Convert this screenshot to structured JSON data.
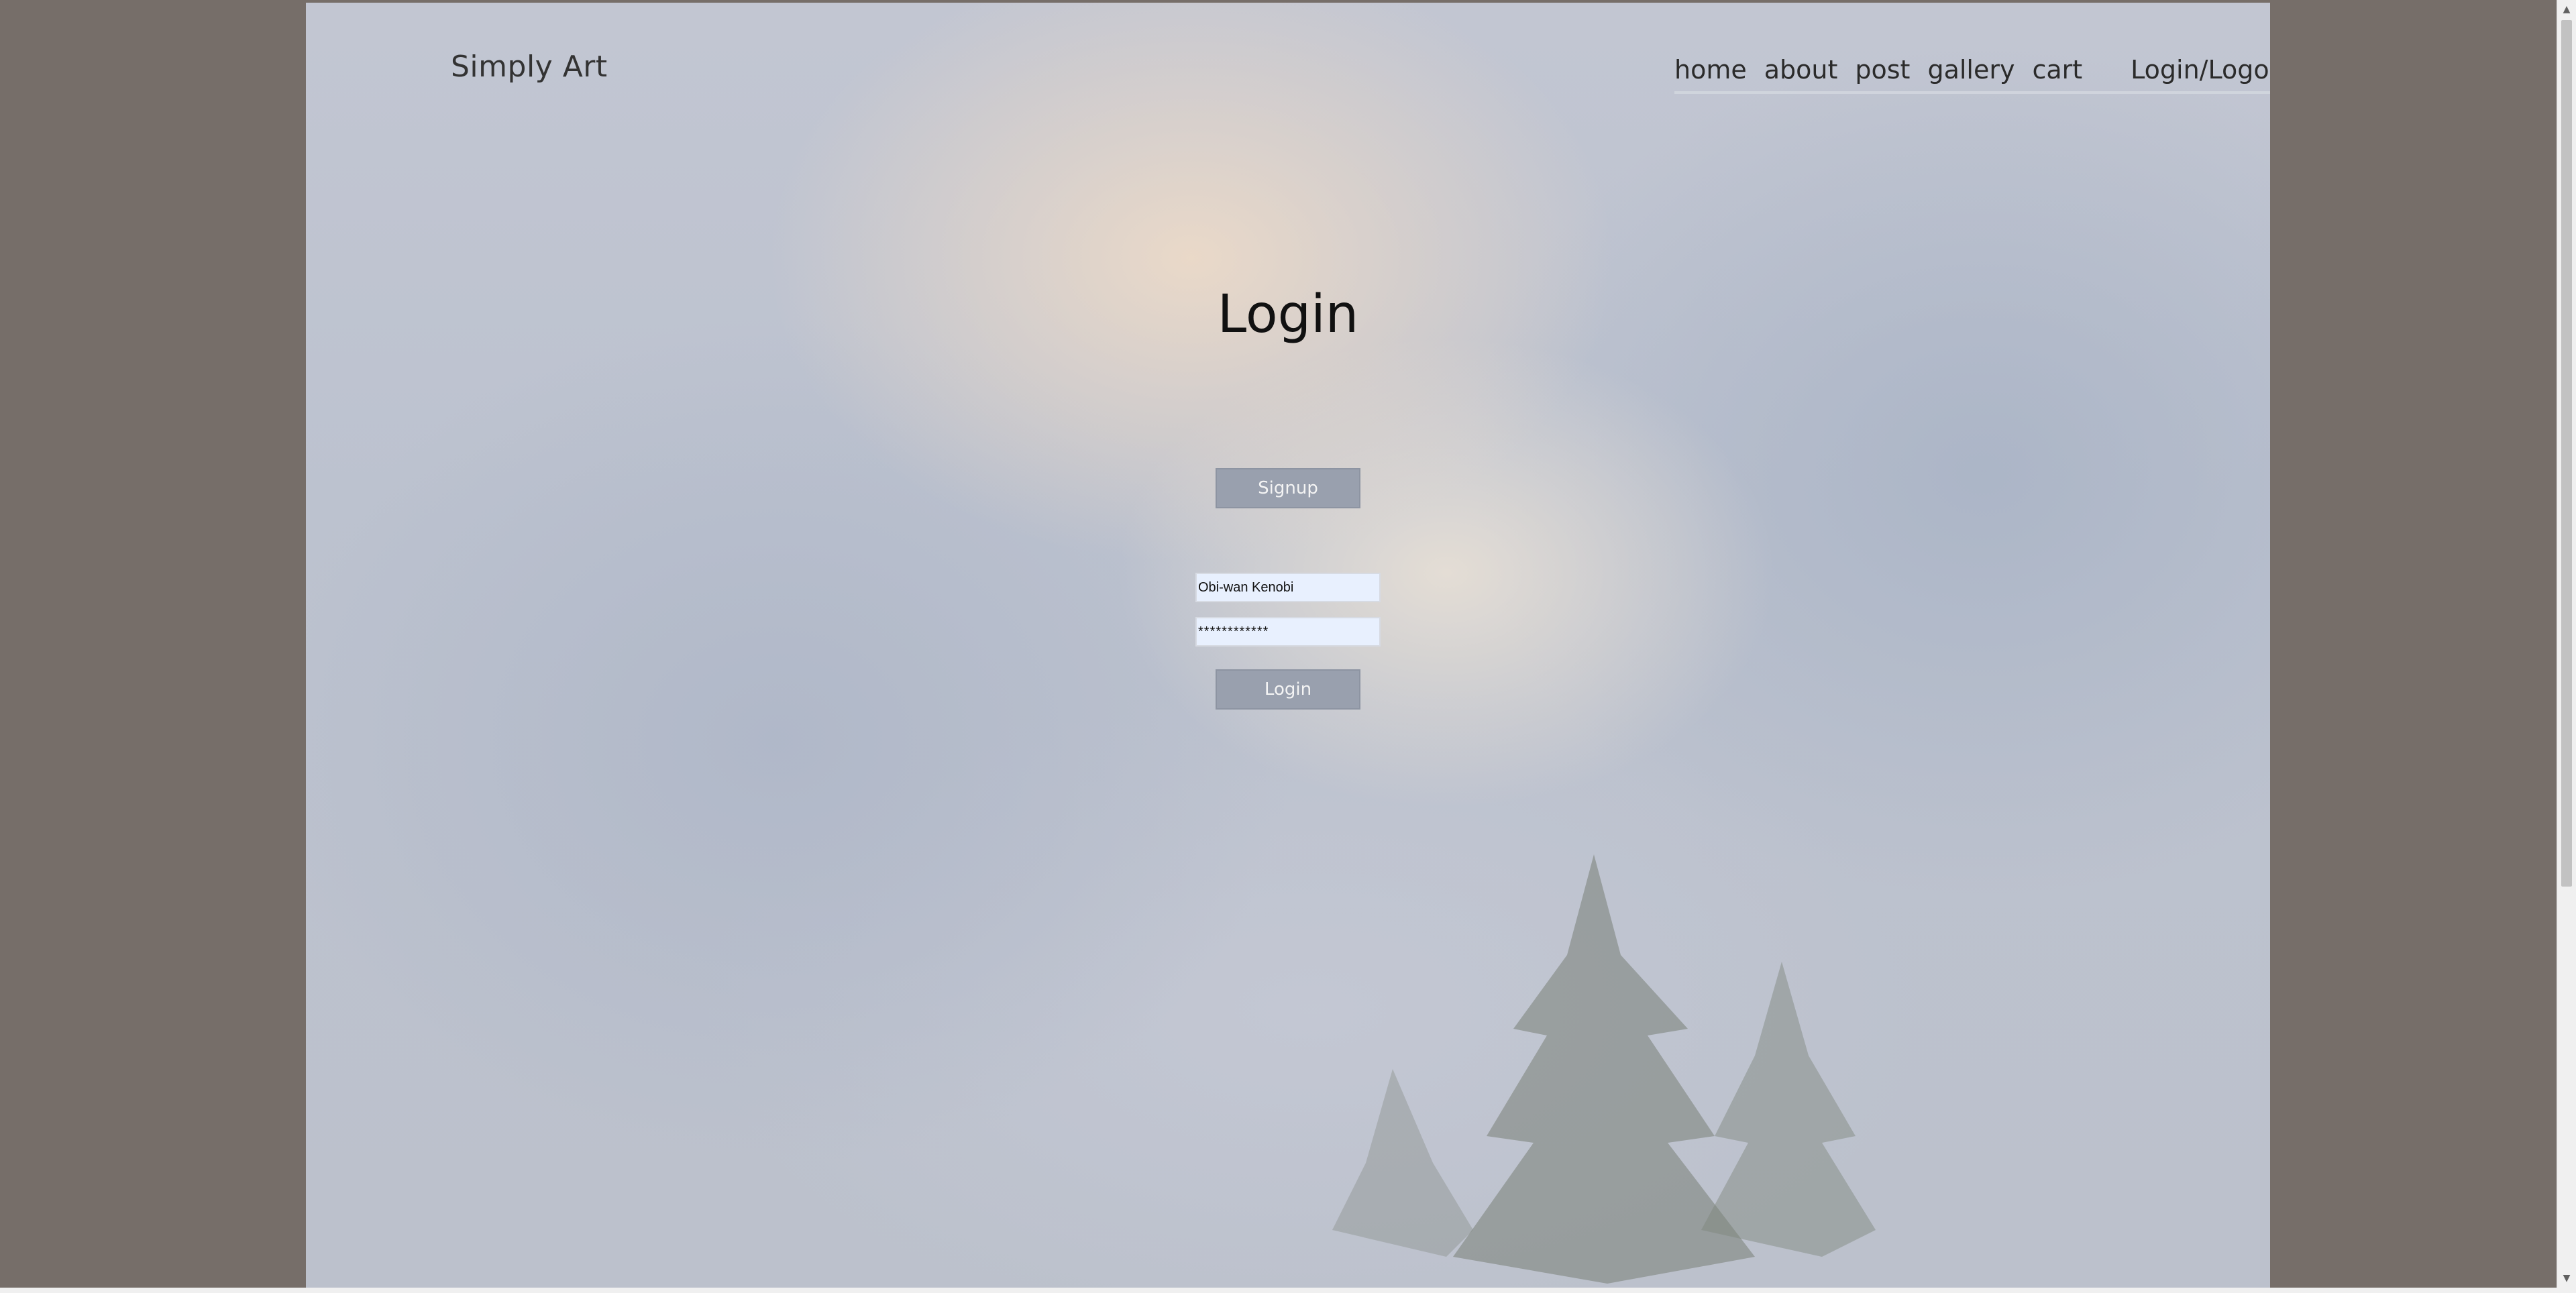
{
  "site": {
    "brand": "Simply Art"
  },
  "nav": {
    "items": [
      {
        "label": "home"
      },
      {
        "label": "about"
      },
      {
        "label": "post"
      },
      {
        "label": "gallery"
      },
      {
        "label": "cart"
      }
    ],
    "login_logout": "Login/Logout"
  },
  "main": {
    "title": "Login",
    "signup_button": "Signup",
    "username_value": "Obi-wan Kenobi",
    "password_value": "************",
    "login_button": "Login"
  },
  "colors": {
    "outer_background": "#766e69",
    "button_bg": "#99a0ae",
    "input_autofill_bg": "#e8f0fe"
  },
  "icons": {
    "scroll_up": "scroll-up-arrow-icon",
    "scroll_down": "scroll-down-arrow-icon"
  }
}
